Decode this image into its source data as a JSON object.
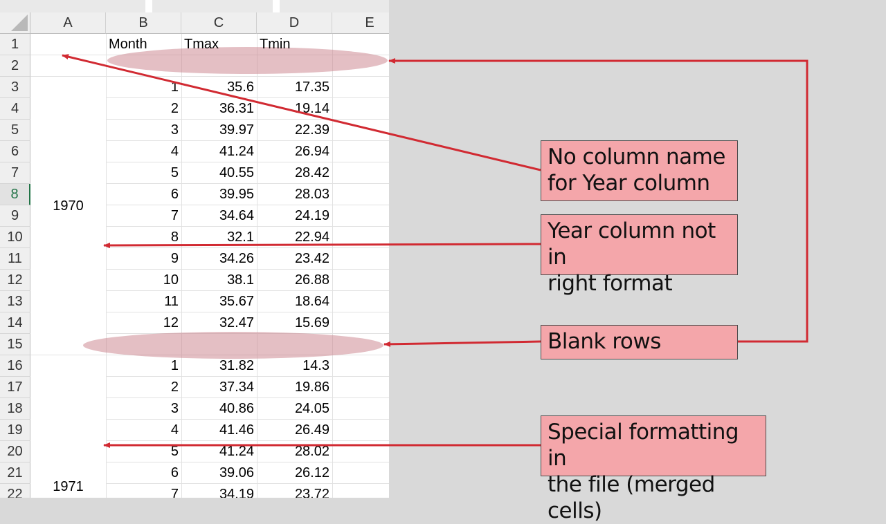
{
  "spreadsheet": {
    "column_headers": [
      "A",
      "B",
      "C",
      "D",
      "E"
    ],
    "row_numbers": [
      "1",
      "2",
      "3",
      "4",
      "5",
      "6",
      "7",
      "8",
      "9",
      "10",
      "11",
      "12",
      "13",
      "14",
      "15",
      "16",
      "17",
      "18",
      "19",
      "20",
      "21",
      "22"
    ],
    "active_row": "8",
    "header_row": {
      "B": "Month",
      "C": "Tmax",
      "D": "Tmin"
    },
    "years": {
      "1970": "1970",
      "1971": "1971"
    },
    "data_rows": [
      {
        "row": 3,
        "month": "1",
        "tmax": "35.6",
        "tmin": "17.35"
      },
      {
        "row": 4,
        "month": "2",
        "tmax": "36.31",
        "tmin": "19.14"
      },
      {
        "row": 5,
        "month": "3",
        "tmax": "39.97",
        "tmin": "22.39"
      },
      {
        "row": 6,
        "month": "4",
        "tmax": "41.24",
        "tmin": "26.94"
      },
      {
        "row": 7,
        "month": "5",
        "tmax": "40.55",
        "tmin": "28.42"
      },
      {
        "row": 8,
        "month": "6",
        "tmax": "39.95",
        "tmin": "28.03"
      },
      {
        "row": 9,
        "month": "7",
        "tmax": "34.64",
        "tmin": "24.19"
      },
      {
        "row": 10,
        "month": "8",
        "tmax": "32.1",
        "tmin": "22.94"
      },
      {
        "row": 11,
        "month": "9",
        "tmax": "34.26",
        "tmin": "23.42"
      },
      {
        "row": 12,
        "month": "10",
        "tmax": "38.1",
        "tmin": "26.88"
      },
      {
        "row": 13,
        "month": "11",
        "tmax": "35.67",
        "tmin": "18.64"
      },
      {
        "row": 14,
        "month": "12",
        "tmax": "32.47",
        "tmin": "15.69"
      },
      {
        "row": 16,
        "month": "1",
        "tmax": "31.82",
        "tmin": "14.3"
      },
      {
        "row": 17,
        "month": "2",
        "tmax": "37.34",
        "tmin": "19.86"
      },
      {
        "row": 18,
        "month": "3",
        "tmax": "40.86",
        "tmin": "24.05"
      },
      {
        "row": 19,
        "month": "4",
        "tmax": "41.46",
        "tmin": "26.49"
      },
      {
        "row": 20,
        "month": "5",
        "tmax": "41.24",
        "tmin": "28.02"
      },
      {
        "row": 21,
        "month": "6",
        "tmax": "39.06",
        "tmin": "26.12"
      },
      {
        "row": 22,
        "month": "7",
        "tmax": "34.19",
        "tmin": "23.72"
      }
    ]
  },
  "annotations": {
    "no_column_name": {
      "line1": "No column name",
      "line2": "for Year column"
    },
    "year_format": {
      "line1": "Year column not in",
      "line2": "right format"
    },
    "blank_rows": {
      "line1": "Blank rows"
    },
    "special_formatting": {
      "line1": "Special formatting in",
      "line2": "the file (merged cells)"
    }
  },
  "colors": {
    "callout_fill": "#f4a6aa",
    "arrow": "#d12a32",
    "highlight_ellipse": "#c9808a",
    "active_row_header": "#217346",
    "background": "#d9d9d9"
  }
}
